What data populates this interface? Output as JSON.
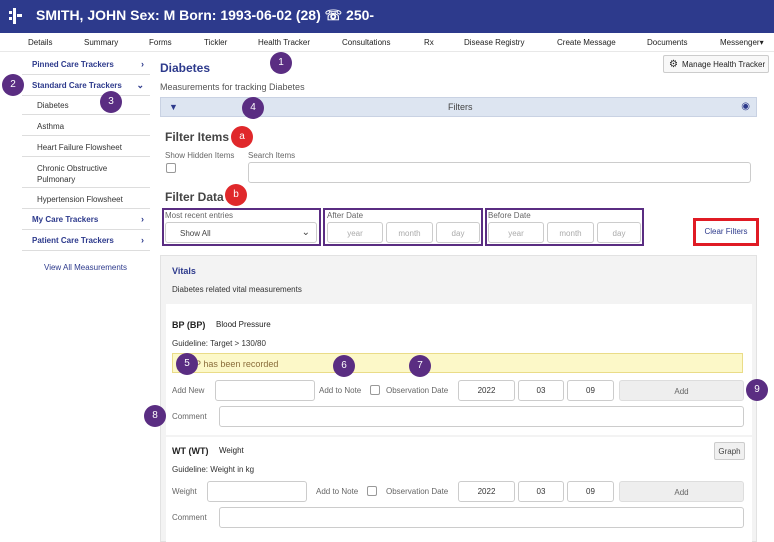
{
  "header": {
    "patient": "SMITH, JOHN  Sex: M Born: 1993-06-02 (28)  ☏ 250-"
  },
  "nav": [
    "Details",
    "Summary",
    "Forms",
    "Tickler",
    "Health Tracker",
    "Consultations",
    "Rx",
    "Disease Registry",
    "Create Message",
    "Documents",
    "Messenger▾"
  ],
  "sidebar": {
    "pinned": "Pinned Care Trackers",
    "standard": "Standard Care Trackers",
    "items": [
      "Diabetes",
      "Asthma",
      "Heart Failure Flowsheet",
      "Chronic Obstructive Pulmonary",
      "Hypertension Flowsheet"
    ],
    "my": "My Care Trackers",
    "patient": "Patient Care Trackers",
    "view_all": "View All Measurements"
  },
  "main": {
    "title": "Diabetes",
    "subtitle": "Measurements for tracking Diabetes",
    "manage_label": "Manage Health Tracker"
  },
  "filters": {
    "title": "Filters",
    "filter_items": "Filter Items",
    "show_hidden": "Show Hidden Items",
    "search_items": "Search Items",
    "filter_data": "Filter Data",
    "most_recent": "Most recent entries",
    "show_all": "Show All",
    "after_date": "After Date",
    "before_date": "Before Date",
    "year_ph": "year",
    "month_ph": "month",
    "day_ph": "day",
    "clear": "Clear Filters"
  },
  "vitals": {
    "title": "Vitals",
    "subtitle": "Diabetes related vital measurements"
  },
  "bp": {
    "code": "BP (BP)",
    "name": "Blood Pressure",
    "guideline": "Guideline: Target > 130/80",
    "warning": "P has been recorded",
    "add_new": "Add New",
    "add_to_note": "Add to Note",
    "obs_date": "Observation Date",
    "year": "2022",
    "month": "03",
    "day": "09",
    "add": "Add",
    "comment": "Comment"
  },
  "wt": {
    "code": "WT (WT)",
    "name": "Weight",
    "graph": "Graph",
    "guideline": "Guideline: Weight in kg",
    "weight": "Weight",
    "add_to_note": "Add to Note",
    "obs_date": "Observation Date",
    "year": "2022",
    "month": "03",
    "day": "09",
    "add": "Add",
    "comment": "Comment"
  },
  "annotations": [
    "1",
    "2",
    "3",
    "4",
    "a",
    "b",
    "5",
    "6",
    "7",
    "8",
    "9"
  ],
  "colors": {
    "brand": "#2d3a8c",
    "annotation": "#5a2d82",
    "highlight_red": "#e01b24"
  }
}
